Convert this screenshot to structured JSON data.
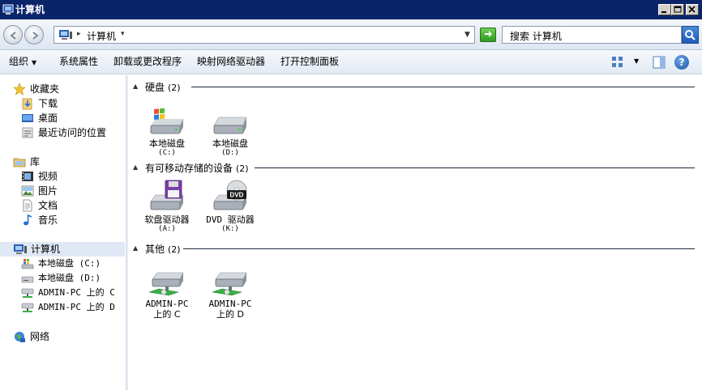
{
  "window": {
    "title": "计算机"
  },
  "address": {
    "path": "计算机",
    "search_placeholder": "搜索 计算机"
  },
  "toolbar": {
    "organize": "组织",
    "system_properties": "系统属性",
    "uninstall": "卸载或更改程序",
    "map_drive": "映射网络驱动器",
    "control_panel": "打开控制面板"
  },
  "nav": {
    "favorites": "收藏夹",
    "downloads": "下载",
    "desktop": "桌面",
    "recent": "最近访问的位置",
    "libraries": "库",
    "videos": "视频",
    "pictures": "图片",
    "documents": "文档",
    "music": "音乐",
    "computer": "计算机",
    "drive_c": "本地磁盘 (C:)",
    "drive_d": "本地磁盘 (D:)",
    "net_c": "ADMIN-PC 上的 C",
    "net_d": "ADMIN-PC 上的 D",
    "network": "网络"
  },
  "groups": {
    "hdd": {
      "title": "硬盘",
      "count": "(2)"
    },
    "removable": {
      "title": "有可移动存储的设备",
      "count": "(2)"
    },
    "other": {
      "title": "其他",
      "count": "(2)"
    }
  },
  "items": {
    "c": {
      "name": "本地磁盘",
      "sub": "(C:)"
    },
    "d": {
      "name": "本地磁盘",
      "sub": "(D:)"
    },
    "a": {
      "name": "软盘驱动器",
      "sub": "(A:)"
    },
    "k": {
      "name": "DVD 驱动器",
      "sub": "(K:)"
    },
    "nc": {
      "name": "ADMIN-PC",
      "sub": "上的 C"
    },
    "nd": {
      "name": "ADMIN-PC",
      "sub": "上的 D"
    }
  },
  "icons": {
    "dvd_badge": "DVD",
    "help": "?"
  }
}
